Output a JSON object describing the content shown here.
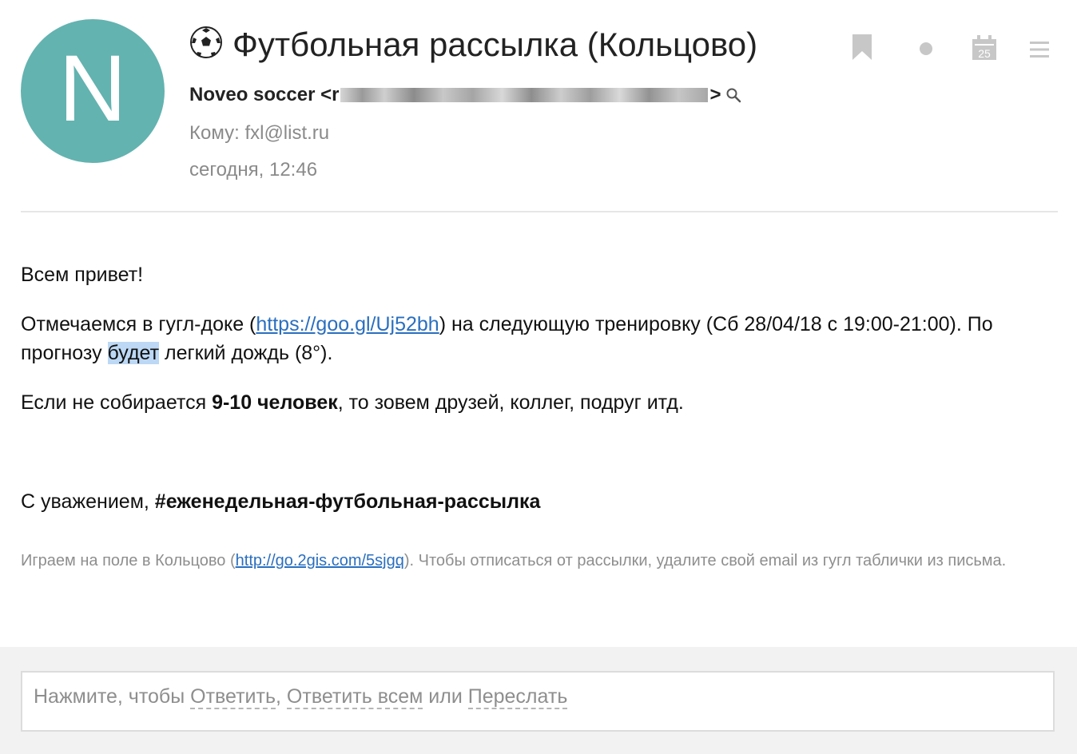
{
  "avatar": {
    "letter": "N",
    "color": "#63b3b0"
  },
  "message": {
    "subject": "Футбольная рассылка (Кольцово)",
    "subject_icon": "soccer-ball-icon",
    "sender_name": "Noveo soccer",
    "sender_open": "<r",
    "sender_close": ">",
    "to_label": "Кому:",
    "to_value": "fxl@list.ru",
    "date": "сегодня, 12:46"
  },
  "toolbar": {
    "icons": [
      "bookmark-icon",
      "dot-icon",
      "calendar-icon",
      "menu-icon"
    ],
    "calendar_day": "25"
  },
  "body": {
    "greeting": "Всем привет!",
    "main_1": "Отмечаемся в гугл-доке (",
    "main_link": "https://goo.gl/Uj52bh",
    "main_2": ") на следующую тренировку (Сб 28/04/18 с 19:00-21:00). По прогнозу ",
    "main_highlight": "будет",
    "main_3": " легкий дождь (8°).",
    "count_1": "Если не собирается ",
    "count_bold": "9-10 человек",
    "count_2": ", то зовем друзей, коллег, подруг итд.",
    "sign_1": "С уважением, ",
    "sign_bold": "#еженедельная-футбольная-рассылка",
    "foot_1": "Играем на поле в Кольцово (",
    "foot_link": "http://go.2gis.com/5sjgq",
    "foot_2": "). Чтобы отписаться от рассылки, удалите свой email из гугл таблички из письма."
  },
  "reply": {
    "prefix": "Нажмите, чтобы ",
    "reply": "Ответить",
    "sep": ", ",
    "reply_all": "Ответить всем",
    "or": " или ",
    "forward": "Переслать"
  },
  "colors": {
    "link": "#2a6fbf",
    "highlight": "#bcd8f4",
    "muted": "#8e8e8e"
  }
}
